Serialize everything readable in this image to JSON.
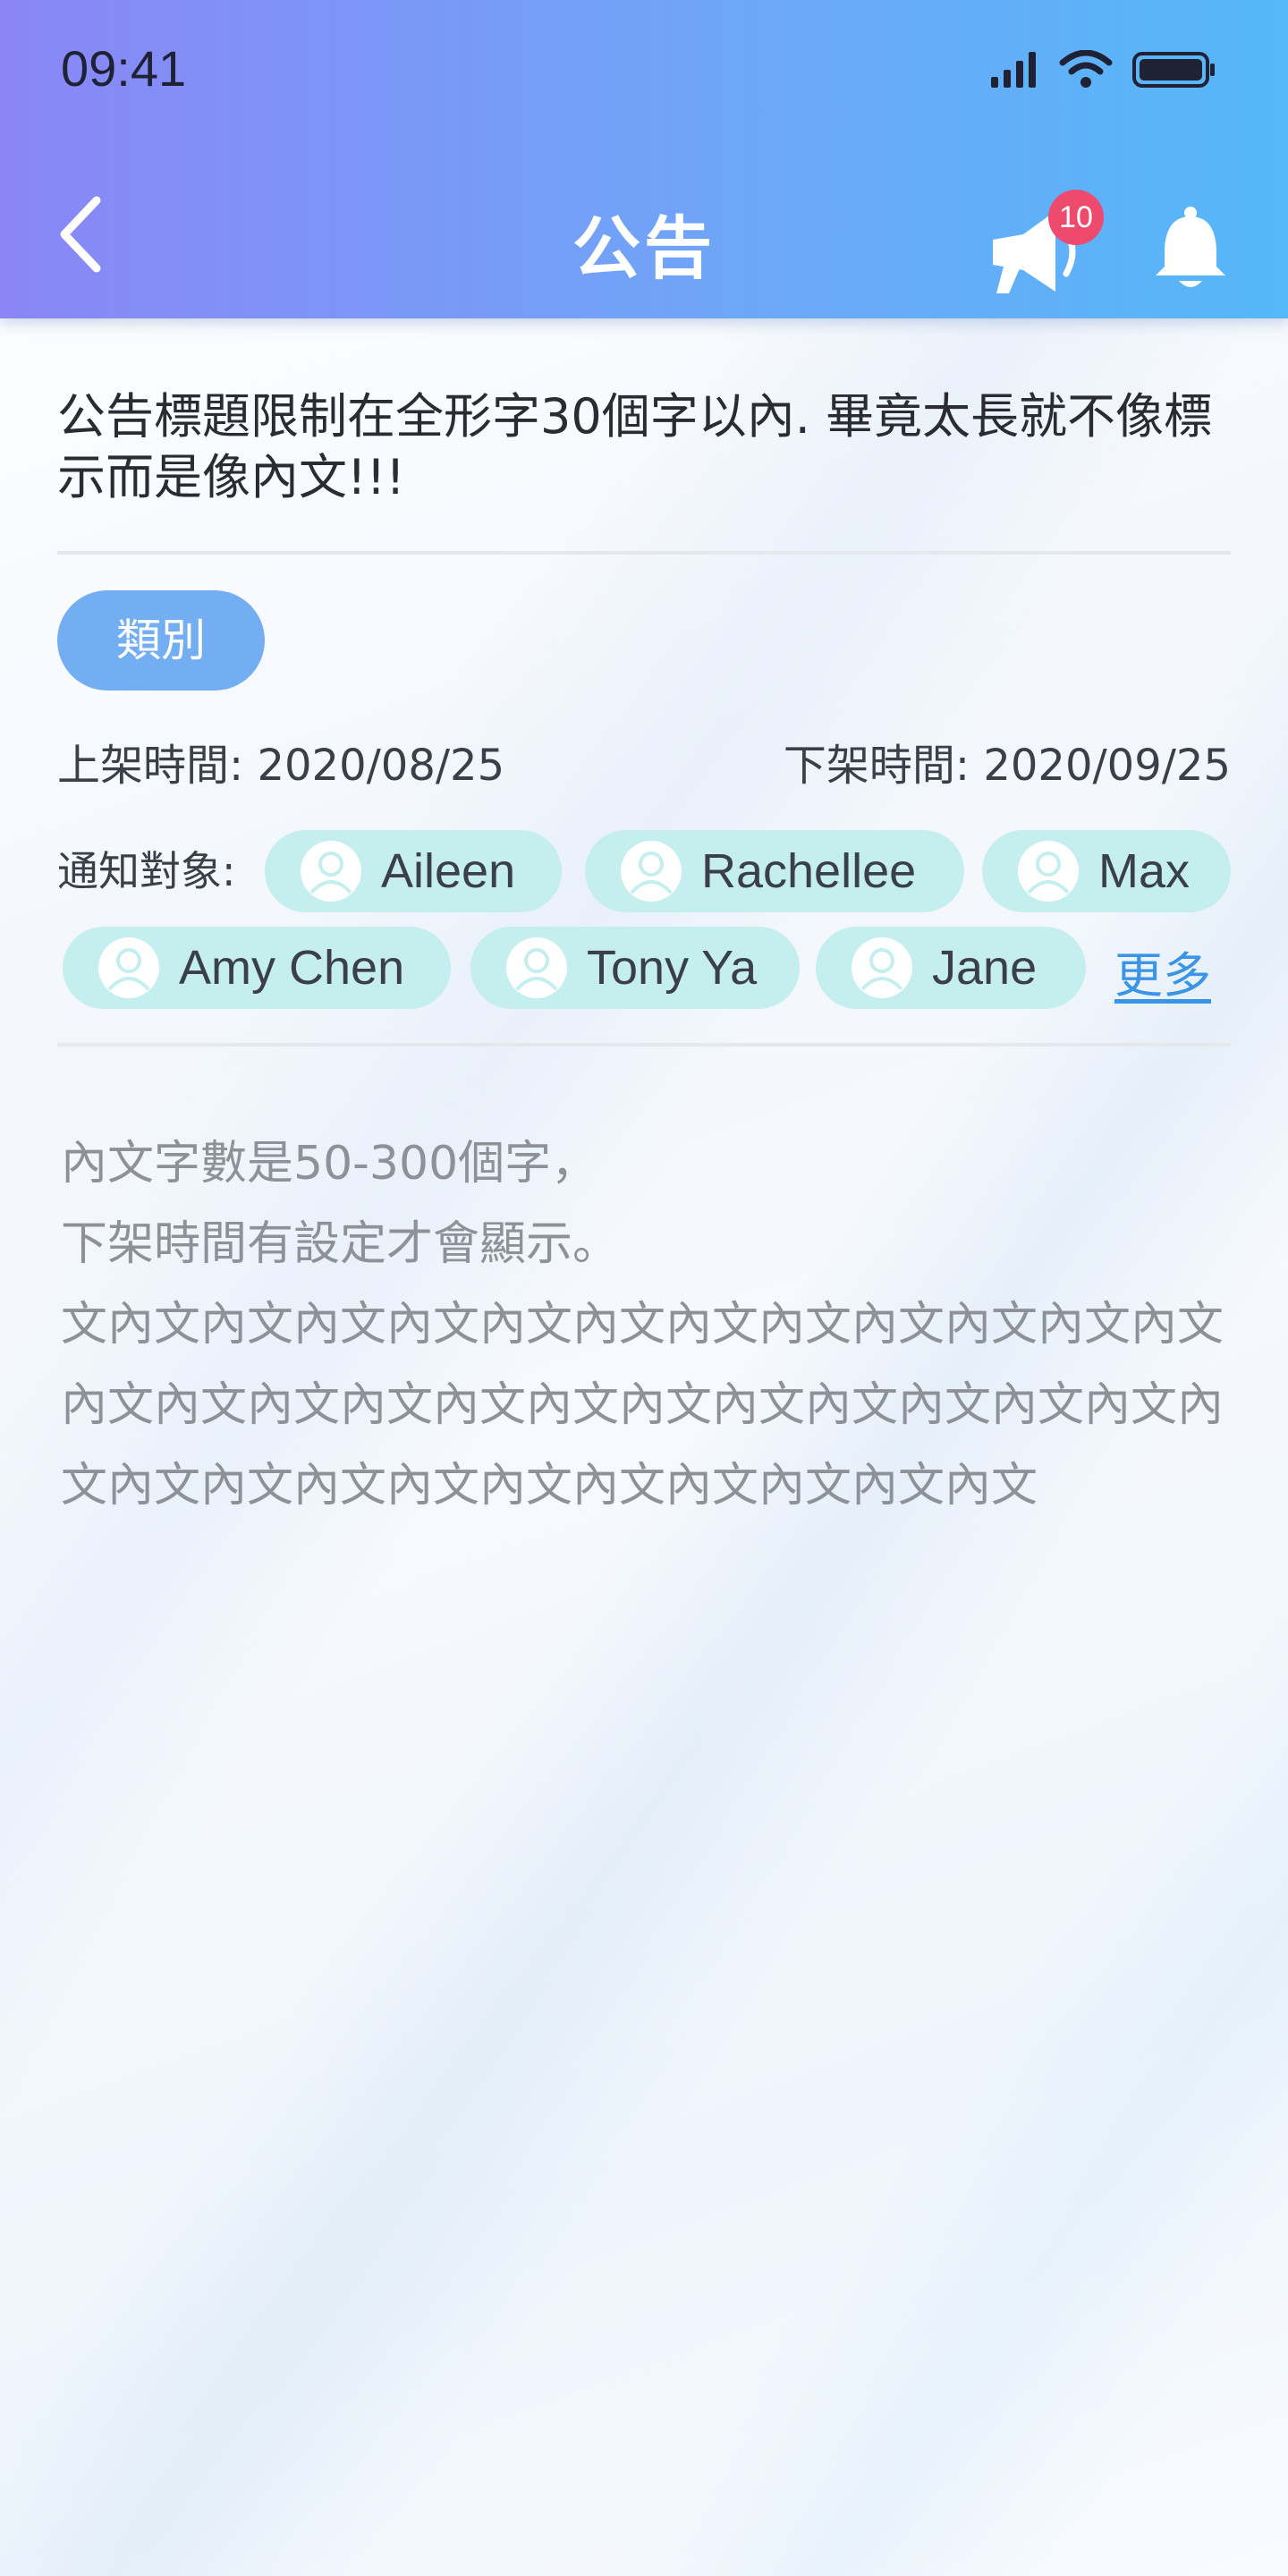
{
  "status_bar": {
    "time": "09:41"
  },
  "header": {
    "title": "公告",
    "badge_count": "10",
    "icons": [
      "back-icon",
      "megaphone-icon",
      "bell-icon"
    ]
  },
  "announcement": {
    "title": "公告標題限制在全形字30個字以內. 畢竟太長就不像標示而是像內文!!!",
    "category": "類別",
    "publish_label": "上架時間:",
    "publish_date": "2020/08/25",
    "unpublish_label": "下架時間:",
    "unpublish_date": "2020/09/25",
    "recipients_label": "通知對象:",
    "recipients": [
      "Aileen",
      "Rachellee",
      "Max",
      "Amy Chen",
      "Tony Ya",
      "Jane"
    ],
    "more_link": "更多",
    "body_lines": [
      "內文字數是50-300個字，",
      "下架時間有設定才會顯示。",
      "文內文內文內文內文內文內文內文內文內文內文內文內文內文內文內文內文內文內文內文內文內文內文內文內文內文內文內文內文內文內文內文內文內文內文內文"
    ]
  },
  "colors": {
    "header_gradient_start": "#8a86f6",
    "header_gradient_end": "#55b8f8",
    "category_bg": "#74aef2",
    "chip_bg": "#c5eeee",
    "badge_bg": "#ee4a6e",
    "link": "#3a95e6"
  }
}
